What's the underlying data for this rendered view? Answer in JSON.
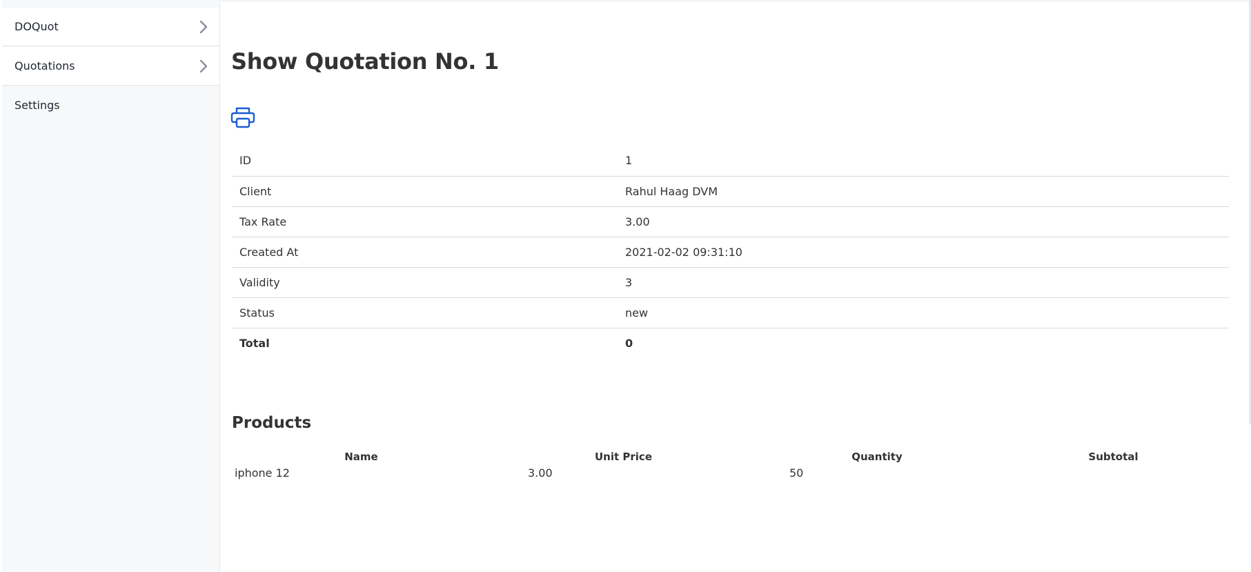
{
  "sidebar": {
    "items": [
      {
        "label": "DOQuot",
        "has_chevron": true
      },
      {
        "label": "Quotations",
        "has_chevron": true
      },
      {
        "label": "Settings",
        "has_chevron": false
      }
    ]
  },
  "page": {
    "title": "Show Quotation No. 1",
    "print_icon": "printer-icon",
    "accent_color": "#1a5bd6"
  },
  "details": {
    "rows": [
      {
        "label": "ID",
        "value": "1"
      },
      {
        "label": "Client",
        "value": "Rahul Haag DVM"
      },
      {
        "label": "Tax Rate",
        "value": "3.00"
      },
      {
        "label": "Created At",
        "value": "2021-02-02 09:31:10"
      },
      {
        "label": "Validity",
        "value": "3"
      },
      {
        "label": "Status",
        "value": "new"
      },
      {
        "label": "Total",
        "value": "0"
      }
    ]
  },
  "products": {
    "title": "Products",
    "columns": [
      "Name",
      "Unit Price",
      "Quantity",
      "Subtotal"
    ],
    "rows": [
      {
        "name": "iphone 12",
        "unit_price": "3.00",
        "quantity": "50",
        "subtotal": ""
      }
    ]
  }
}
